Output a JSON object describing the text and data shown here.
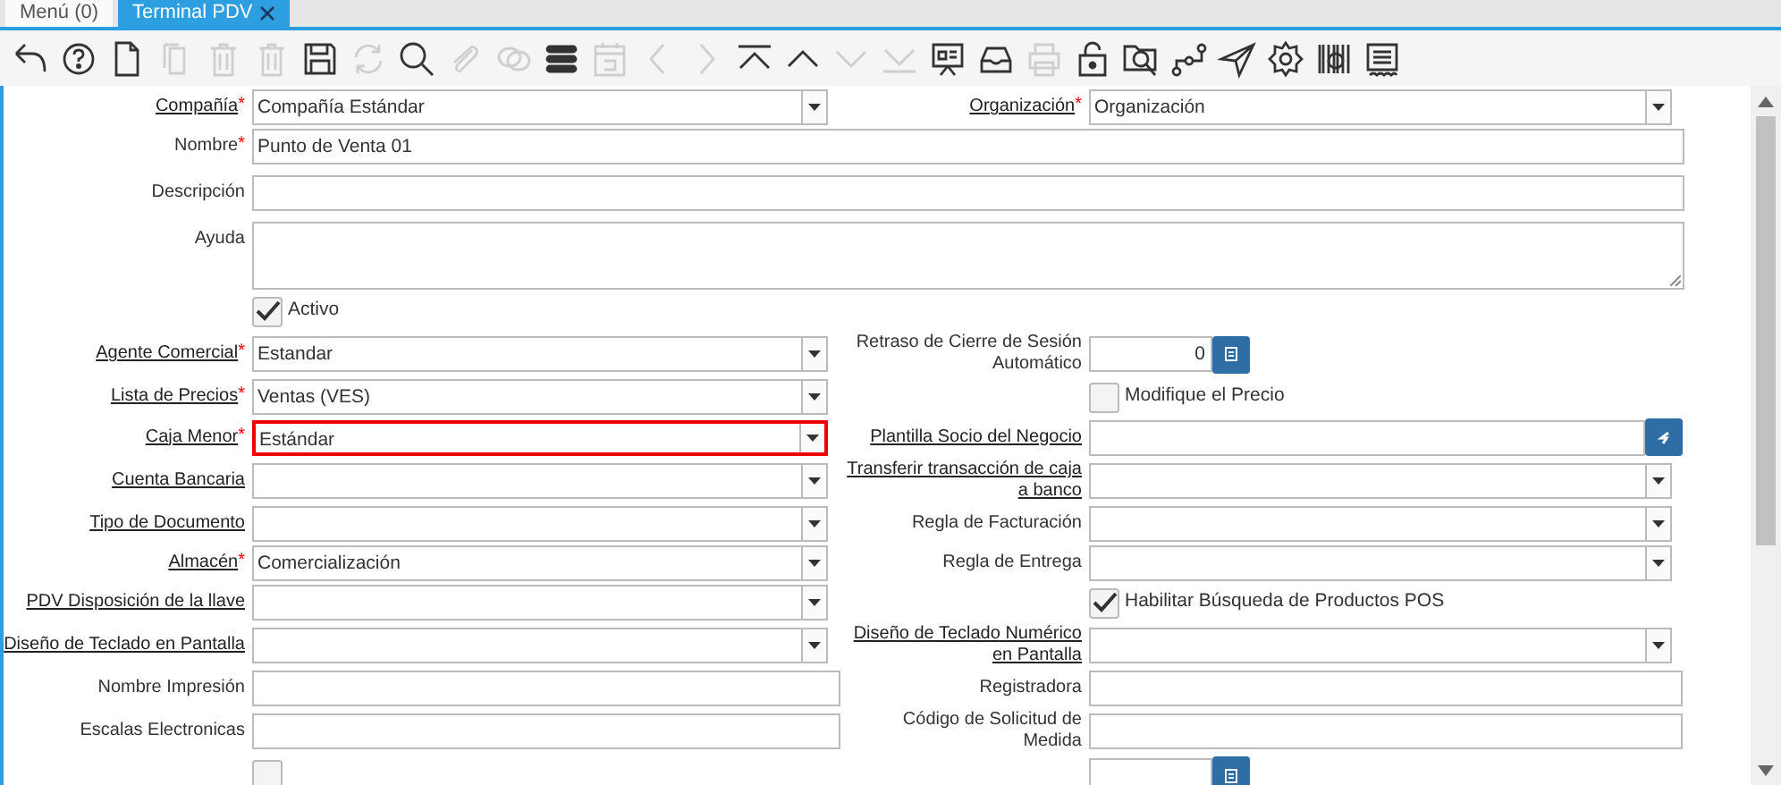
{
  "tabs": [
    {
      "label": "Menú (0)",
      "selected": false
    },
    {
      "label": "Terminal PDV",
      "selected": true,
      "closable": true
    }
  ],
  "toolbar": [
    {
      "kind": "undo",
      "disabled": false
    },
    {
      "kind": "help",
      "disabled": false
    },
    {
      "kind": "new",
      "disabled": false
    },
    {
      "kind": "copy",
      "disabled": true
    },
    {
      "kind": "delete",
      "disabled": true
    },
    {
      "kind": "delete",
      "disabled": true
    },
    {
      "kind": "save",
      "disabled": false
    },
    {
      "kind": "refresh",
      "disabled": true
    },
    {
      "kind": "search",
      "disabled": false
    },
    {
      "kind": "attach",
      "disabled": true
    },
    {
      "kind": "chat",
      "disabled": true
    },
    {
      "kind": "list",
      "disabled": false
    },
    {
      "kind": "calendar",
      "disabled": true
    },
    {
      "kind": "left",
      "disabled": true
    },
    {
      "kind": "right",
      "disabled": true
    },
    {
      "kind": "first",
      "disabled": false
    },
    {
      "kind": "up",
      "disabled": false
    },
    {
      "kind": "down",
      "disabled": true
    },
    {
      "kind": "last",
      "disabled": true
    },
    {
      "kind": "report",
      "disabled": false
    },
    {
      "kind": "tray",
      "disabled": false
    },
    {
      "kind": "print",
      "disabled": true
    },
    {
      "kind": "lock",
      "disabled": false
    },
    {
      "kind": "zoom",
      "disabled": false
    },
    {
      "kind": "workflow",
      "disabled": false
    },
    {
      "kind": "send",
      "disabled": false
    },
    {
      "kind": "gear",
      "disabled": false
    },
    {
      "kind": "barcode",
      "disabled": false
    },
    {
      "kind": "product",
      "disabled": false
    }
  ],
  "rows": [
    {
      "left": {
        "kind": "select",
        "label": "Compañía",
        "marker": "*",
        "link": true,
        "value": "Compañía Estándar"
      },
      "right": {
        "kind": "select",
        "label": "Organización",
        "marker": "*",
        "link": true,
        "value": "Organización"
      }
    },
    {
      "full": {
        "kind": "text",
        "label": "Nombre",
        "marker": "*",
        "link": false,
        "value": "Punto de Venta 01"
      }
    },
    {
      "full": {
        "kind": "text",
        "label": "Descripción",
        "link": false
      }
    },
    {
      "full": {
        "kind": "textarea",
        "label": "Ayuda",
        "link": false
      }
    },
    {
      "left": {
        "kind": "checkbox",
        "label": "Activo",
        "checked": true
      }
    },
    {
      "left": {
        "kind": "select",
        "label": "Agente Comercial",
        "marker": "*",
        "link": true,
        "value": "Estandar"
      },
      "right": {
        "kind": "number",
        "label": "Retraso de Cierre de Sesión Automático",
        "link": false,
        "value": "0"
      }
    },
    {
      "left": {
        "kind": "select",
        "label": "Lista de Precios",
        "marker": "*",
        "link": true,
        "value": "Ventas (VES)"
      },
      "right": {
        "kind": "checkbox",
        "label": "Modifique el Precio",
        "checked": false
      }
    },
    {
      "left": {
        "kind": "select",
        "label": "Caja Menor",
        "marker": "*",
        "link": true,
        "value": "Estándar",
        "highlighted": true
      },
      "right": {
        "kind": "search",
        "label": "Plantilla Socio del Negocio",
        "link": true
      }
    },
    {
      "left": {
        "kind": "select",
        "label": "Cuenta Bancaria",
        "link": true
      },
      "right": {
        "kind": "select",
        "label": "Transferir transacción de caja a banco",
        "link": true
      }
    },
    {
      "left": {
        "kind": "select",
        "label": "Tipo de Documento",
        "link": true
      },
      "right": {
        "kind": "select",
        "label": "Regla de Facturación",
        "link": false
      }
    },
    {
      "left": {
        "kind": "select",
        "label": "Almacén",
        "marker": "*",
        "link": true,
        "value": "Comercialización"
      },
      "right": {
        "kind": "select",
        "label": "Regla de Entrega",
        "link": false
      }
    },
    {
      "left": {
        "kind": "select",
        "label": "PDV Disposición de la llave",
        "link": true
      },
      "right": {
        "kind": "checkbox",
        "label": "Habilitar Búsqueda de Productos POS",
        "checked": true
      }
    },
    {
      "left": {
        "kind": "select",
        "label": "Diseño de Teclado en Pantalla",
        "link": true
      },
      "right": {
        "kind": "select",
        "label": "Diseño de Teclado Numérico en Pantalla",
        "link": true
      }
    },
    {
      "left": {
        "kind": "text",
        "label": "Nombre Impresión",
        "link": false
      },
      "right": {
        "kind": "text",
        "label": "Registradora",
        "link": false
      }
    },
    {
      "left": {
        "kind": "text",
        "label": "Escalas Electronicas",
        "link": false
      },
      "right": {
        "kind": "text",
        "label": "Código de Solicitud de Medida",
        "link": false
      }
    },
    {
      "left": {
        "kind": "checkbox",
        "checked": false
      },
      "right": {
        "kind": "number"
      }
    }
  ]
}
